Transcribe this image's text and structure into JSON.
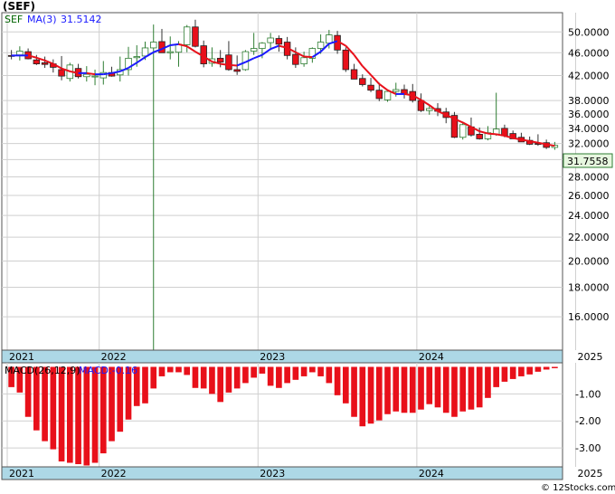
{
  "header": {
    "ticker": "(SEF)",
    "ticker_label": "SEF",
    "ma_label": "MA(3)",
    "ma_value": "31.5142",
    "macd_label": "MACD(26,12,9)",
    "macd_value_label": "MACD:-0.16",
    "last_price": "31.7558",
    "watermark": "© 12Stocks.com"
  },
  "colors": {
    "up_body": "#ffffff",
    "up_outline": "#2e7d32",
    "down_body": "#e8101a",
    "ma_up": "#1a1aff",
    "ma_down": "#e8101a",
    "macd_bar": "#e8101a",
    "year_band": "#add8e6",
    "grid": "#cfcfcf",
    "price_box_bg": "#e7f7e0"
  },
  "chart_data": [
    {
      "type": "candlestick",
      "title": "(SEF)",
      "xlabel": "",
      "ylabel": "",
      "y_scale": "log",
      "ylim": [
        14.0,
        54.0
      ],
      "y_ticks": [
        "50.0000",
        "46.0000",
        "42.0000",
        "38.0000",
        "36.0000",
        "34.0000",
        "32.0000",
        "30.0000",
        "28.0000",
        "26.0000",
        "24.0000",
        "22.0000",
        "20.0000",
        "18.0000",
        "16.0000"
      ],
      "y_tick_values": [
        50,
        46,
        42,
        38,
        36,
        34,
        32,
        30,
        28,
        26,
        24,
        22,
        20,
        18,
        16
      ],
      "x_labels": [
        "2021",
        "2022",
        "2023",
        "2024",
        "2025"
      ],
      "x_label_index": [
        0,
        11,
        30,
        49,
        68
      ],
      "grid": true,
      "last_price": 31.7558,
      "ohlc": [
        [
          45.5,
          46.5,
          44.8,
          45.4
        ],
        [
          45.6,
          47.2,
          44.6,
          46.3
        ],
        [
          46.2,
          46.8,
          44.8,
          44.9
        ],
        [
          44.7,
          45.6,
          43.8,
          44.0
        ],
        [
          44.2,
          45.3,
          43.3,
          43.9
        ],
        [
          44.0,
          44.8,
          42.5,
          43.4
        ],
        [
          43.0,
          45.4,
          41.2,
          41.9
        ],
        [
          41.5,
          44.2,
          41.0,
          43.8
        ],
        [
          43.2,
          44.0,
          41.5,
          41.8
        ],
        [
          41.8,
          43.6,
          41.0,
          42.2
        ],
        [
          41.8,
          43.0,
          40.4,
          41.9
        ],
        [
          41.6,
          44.5,
          40.5,
          42.5
        ],
        [
          42.5,
          43.5,
          41.8,
          41.9
        ],
        [
          42.1,
          45.3,
          41.0,
          43.0
        ],
        [
          43.0,
          47.1,
          42.0,
          45.0
        ],
        [
          45.1,
          47.4,
          43.5,
          45.3
        ],
        [
          45.4,
          48.1,
          44.7,
          46.9
        ],
        [
          46.9,
          51.5,
          14.0,
          48.0
        ],
        [
          48.1,
          50.6,
          46.5,
          46.0
        ],
        [
          46.0,
          49.1,
          44.8,
          46.2
        ],
        [
          46.1,
          48.2,
          43.5,
          47.6
        ],
        [
          47.5,
          51.4,
          46.1,
          51.0
        ],
        [
          51.0,
          52.5,
          47.0,
          47.2
        ],
        [
          47.3,
          48.3,
          43.4,
          44.0
        ],
        [
          44.1,
          47.0,
          43.5,
          44.9
        ],
        [
          45.0,
          46.5,
          43.4,
          44.3
        ],
        [
          45.6,
          48.2,
          42.8,
          43.0
        ],
        [
          43.0,
          45.5,
          42.1,
          42.7
        ],
        [
          43.0,
          46.5,
          42.8,
          46.2
        ],
        [
          46.3,
          49.8,
          45.6,
          46.8
        ],
        [
          46.8,
          48.0,
          45.0,
          47.8
        ],
        [
          47.9,
          49.8,
          46.5,
          48.8
        ],
        [
          48.7,
          49.3,
          46.2,
          47.6
        ],
        [
          48.0,
          49.0,
          44.8,
          45.5
        ],
        [
          45.7,
          47.0,
          43.3,
          43.9
        ],
        [
          44.0,
          46.2,
          43.5,
          45.1
        ],
        [
          45.0,
          47.0,
          44.2,
          46.8
        ],
        [
          46.8,
          49.5,
          45.8,
          48.0
        ],
        [
          47.8,
          50.4,
          46.8,
          49.4
        ],
        [
          49.3,
          50.2,
          45.8,
          46.5
        ],
        [
          46.5,
          47.0,
          42.6,
          43.0
        ],
        [
          43.0,
          44.0,
          41.8,
          41.4
        ],
        [
          41.5,
          42.2,
          40.2,
          40.5
        ],
        [
          40.4,
          41.6,
          39.3,
          39.6
        ],
        [
          39.6,
          40.8,
          37.9,
          38.3
        ],
        [
          38.1,
          39.6,
          37.8,
          39.4
        ],
        [
          39.4,
          40.8,
          38.6,
          39.7
        ],
        [
          39.7,
          40.5,
          38.3,
          39.0
        ],
        [
          39.4,
          40.6,
          37.7,
          38.0
        ],
        [
          38.0,
          39.1,
          36.3,
          36.5
        ],
        [
          36.5,
          37.2,
          35.9,
          36.8
        ],
        [
          36.8,
          37.6,
          35.7,
          36.4
        ],
        [
          36.3,
          36.9,
          34.7,
          35.5
        ],
        [
          35.8,
          36.3,
          32.7,
          32.8
        ],
        [
          32.8,
          34.9,
          32.5,
          34.5
        ],
        [
          34.2,
          35.5,
          32.9,
          33.1
        ],
        [
          33.2,
          34.1,
          32.5,
          32.6
        ],
        [
          32.6,
          34.3,
          32.4,
          33.4
        ],
        [
          33.2,
          39.2,
          33.0,
          33.9
        ],
        [
          34.0,
          34.5,
          32.8,
          33.0
        ],
        [
          33.3,
          33.7,
          32.7,
          32.6
        ],
        [
          32.8,
          33.4,
          32.3,
          32.2
        ],
        [
          32.4,
          32.9,
          31.8,
          31.9
        ],
        [
          32.0,
          33.2,
          31.7,
          31.9
        ],
        [
          32.1,
          32.5,
          31.3,
          31.5
        ],
        [
          31.5,
          32.2,
          31.2,
          31.76
        ]
      ],
      "ma3": [
        45.5,
        45.5,
        45.5,
        45.1,
        44.6,
        44.0,
        43.2,
        42.7,
        42.4,
        42.4,
        42.2,
        42.2,
        42.4,
        42.7,
        43.3,
        44.2,
        45.2,
        46.1,
        46.7,
        47.4,
        47.6,
        47.2,
        46.2,
        45.3,
        44.4,
        44.0,
        43.8,
        43.7,
        44.3,
        45.0,
        45.6,
        46.7,
        47.3,
        46.9,
        46.1,
        45.3,
        45.2,
        46.2,
        47.7,
        48.2,
        47.3,
        45.6,
        43.6,
        42.1,
        40.6,
        39.6,
        39.0,
        39.0,
        38.8,
        38.1,
        37.3,
        36.4,
        35.9,
        35.3,
        34.8,
        34.2,
        33.6,
        33.3,
        33.2,
        33.0,
        32.7,
        32.5,
        32.3,
        32.1,
        31.9,
        31.7
      ]
    },
    {
      "type": "bar",
      "title": "MACD(26,12,9)",
      "xlabel": "",
      "ylabel": "",
      "ylim": [
        -3.7,
        0.15
      ],
      "y_ticks": [
        "-1.00",
        "-2.00",
        "-3.00"
      ],
      "y_tick_values": [
        -1,
        -2,
        -3
      ],
      "x_labels": [
        "2021",
        "2022",
        "2023",
        "2024",
        "2025"
      ],
      "x_label_index": [
        0,
        11,
        30,
        49,
        68
      ],
      "grid": true,
      "values": [
        -0.75,
        -0.95,
        -1.85,
        -2.35,
        -2.75,
        -3.05,
        -3.5,
        -3.55,
        -3.6,
        -3.65,
        -3.55,
        -3.2,
        -2.75,
        -2.4,
        -1.95,
        -1.45,
        -1.35,
        -0.8,
        -0.35,
        -0.2,
        -0.2,
        -0.3,
        -0.78,
        -0.8,
        -1.0,
        -1.3,
        -0.95,
        -0.8,
        -0.6,
        -0.4,
        -0.25,
        -0.7,
        -0.78,
        -0.6,
        -0.48,
        -0.35,
        -0.2,
        -0.35,
        -0.6,
        -1.05,
        -1.35,
        -1.85,
        -2.2,
        -2.1,
        -1.98,
        -1.75,
        -1.65,
        -1.7,
        -1.7,
        -1.58,
        -1.38,
        -1.5,
        -1.7,
        -1.85,
        -1.65,
        -1.58,
        -1.5,
        -1.15,
        -0.75,
        -0.55,
        -0.45,
        -0.35,
        -0.28,
        -0.18,
        -0.1,
        -0.05
      ]
    }
  ]
}
